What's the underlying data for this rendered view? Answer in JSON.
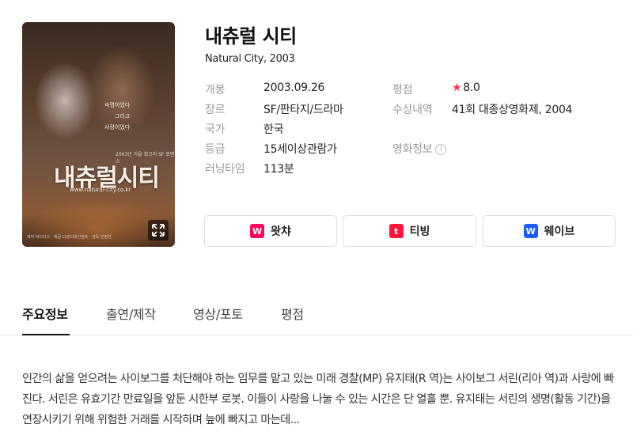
{
  "poster": {
    "title_text": "내츄럴시티",
    "tagline": "숙명이었다\n그리고\n사랑이었다",
    "sub_text": "2003년 가을 최고의 SF 로맨스",
    "url_text": "www.natural-city.co.kr",
    "credits_text": "제작 싸이더스 · 배급 CJ엔터테인먼트 · 감독 민병천"
  },
  "movie": {
    "title": "내츄럴 시티",
    "original": "Natural City, 2003"
  },
  "info_left": [
    {
      "label": "개봉",
      "value": "2003.09.26"
    },
    {
      "label": "장르",
      "value": "SF/판타지/드라마"
    },
    {
      "label": "국가",
      "value": "한국"
    },
    {
      "label": "등급",
      "value": "15세이상관람가"
    },
    {
      "label": "러닝타임",
      "value": "113분"
    }
  ],
  "info_right": {
    "rating_label": "평점",
    "rating_value": "8.0",
    "award_label": "수상내역",
    "award_value": "41회 대종상영화제, 2004",
    "info_label": "영화정보",
    "info_icon": "!"
  },
  "ott": [
    {
      "name": "왓챠",
      "icon": "W",
      "color": "#ff0558"
    },
    {
      "name": "티빙",
      "icon": "t",
      "color": "#ff153c"
    },
    {
      "name": "웨이브",
      "icon": "W",
      "color": "#1f5cff"
    }
  ],
  "tabs": [
    "주요정보",
    "출연/제작",
    "영상/포토",
    "평점"
  ],
  "synopsis": "인간의 삶을 얻으려는 사이보그를 처단해야 하는 임무를 맡고 있는 미래 경찰(MP) 유지태(R 역)는 사이보그 서린(리아 역)과 사랑에 빠진다. 서린은 유효기간 만료일을 앞둔 시한부 로봇. 이들이 사랑을 나눌 수 있는 시간은 단 열흘 뿐. 유지태는 서린의 생명(활동 기간)을 연장시키기 위해 위험한 거래를 시작하며 늪에 빠지고 마는데..."
}
